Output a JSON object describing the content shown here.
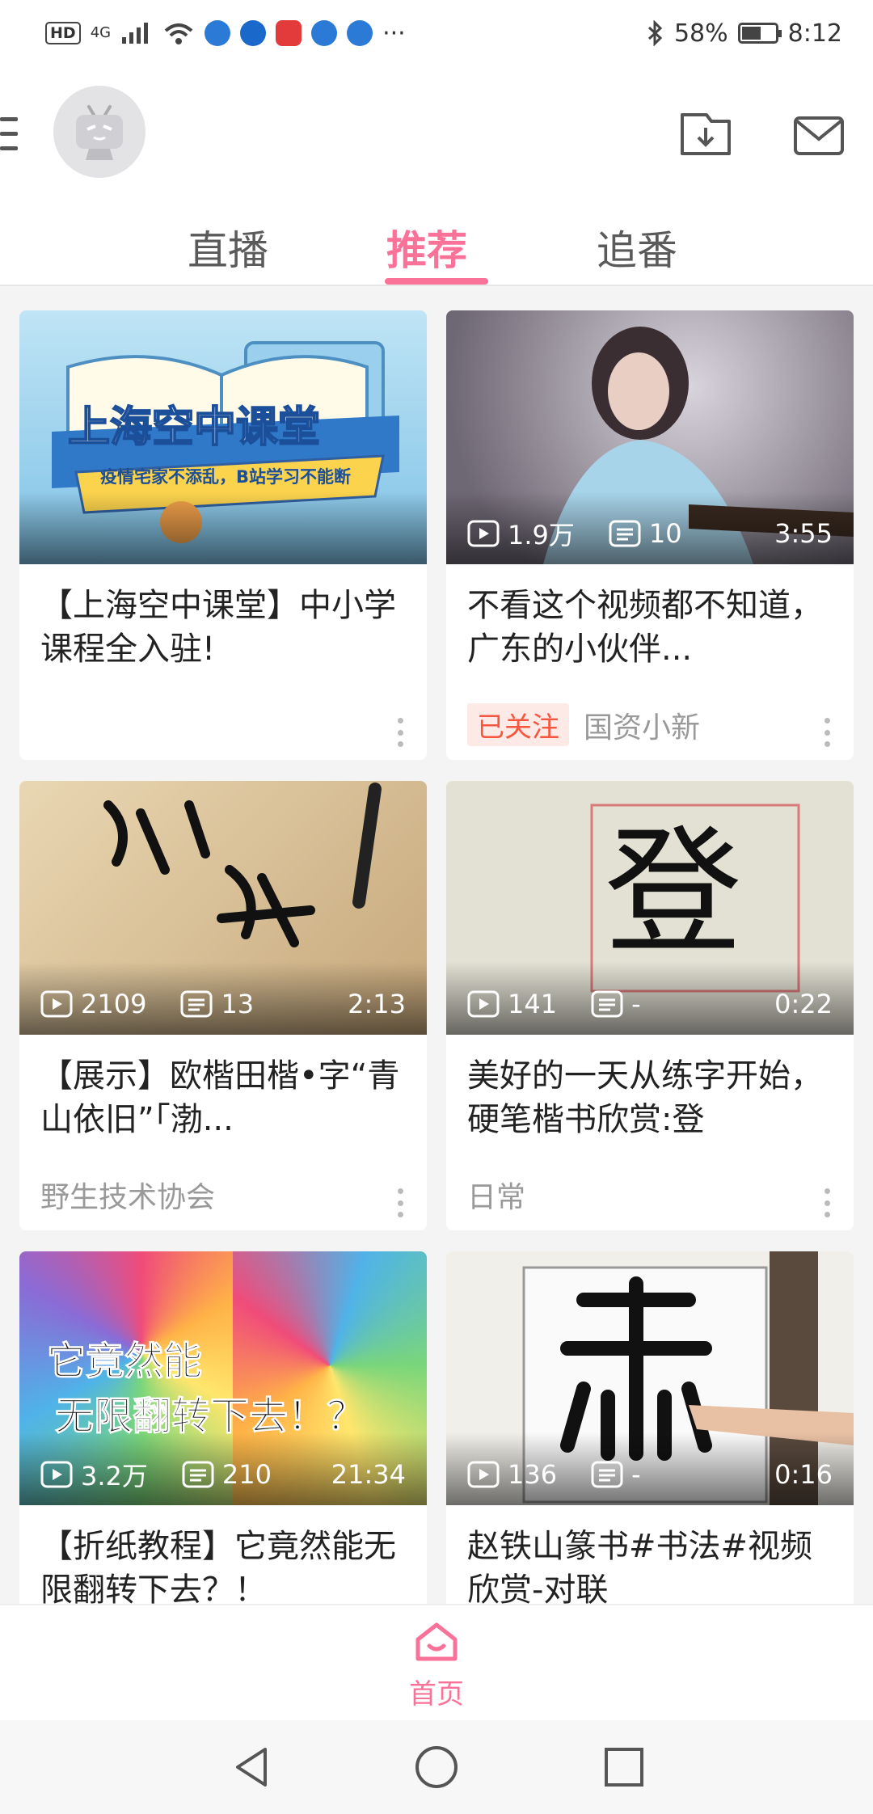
{
  "status_bar": {
    "hd": "HD",
    "network": "4G",
    "battery_percent": "58%",
    "battery_level": 0.58,
    "time": "8:12",
    "more": "···"
  },
  "header": {
    "tabs": [
      {
        "label": "直播",
        "active": false
      },
      {
        "label": "推荐",
        "active": true
      },
      {
        "label": "追番",
        "active": false
      }
    ],
    "accent_color": "#fb7299"
  },
  "cards": [
    {
      "thumb_text_1": "上海空中课堂",
      "thumb_text_2": "疫情宅家不添乱，B站学习不能断",
      "title": "【上海空中课堂】中小学课程全入驻!",
      "views": "",
      "comments": "",
      "duration": "",
      "followed": "",
      "uploader": ""
    },
    {
      "thumb_text_1": "",
      "thumb_text_2": "",
      "title": "不看这个视频都不知道，广东的小伙伴...",
      "views": "1.9万",
      "comments": "10",
      "duration": "3:55",
      "followed": "已关注",
      "uploader": "国资小新"
    },
    {
      "thumb_text_1": "",
      "thumb_text_2": "",
      "title": "【展示】欧楷田楷•字“青山依旧”「渤...",
      "views": "2109",
      "comments": "13",
      "duration": "2:13",
      "followed": "",
      "uploader": "野生技术协会"
    },
    {
      "thumb_text_1": "登",
      "thumb_text_2": "",
      "title": "美好的一天从练字开始，硬笔楷书欣赏:登",
      "views": "141",
      "comments": "-",
      "duration": "0:22",
      "followed": "",
      "uploader": "日常"
    },
    {
      "thumb_text_1": "它竟然能",
      "thumb_text_2": "无限翻转下去！？",
      "title": "【折纸教程】它竟然能无限翻转下去？！",
      "views": "3.2万",
      "comments": "210",
      "duration": "21:34",
      "followed": "",
      "uploader": ""
    },
    {
      "thumb_text_1": "",
      "thumb_text_2": "",
      "title": "赵铁山篆书#书法#视频欣赏-对联",
      "views": "136",
      "comments": "-",
      "duration": "0:16",
      "followed": "",
      "uploader": ""
    }
  ],
  "bottom_nav": {
    "home_label": "首页"
  }
}
